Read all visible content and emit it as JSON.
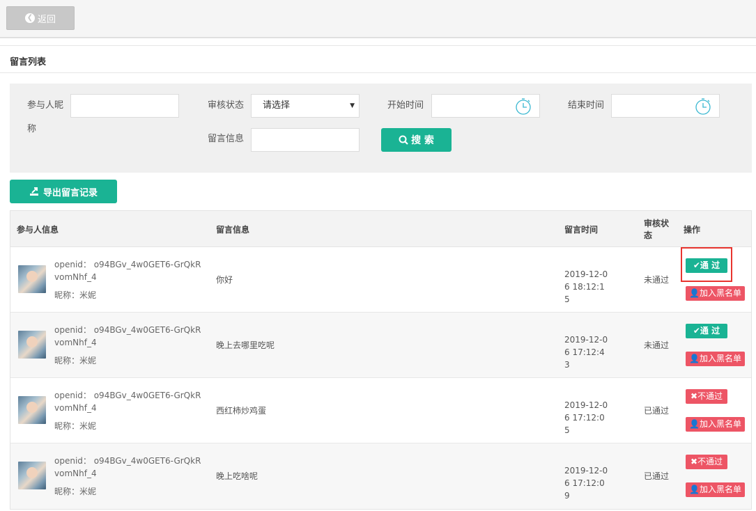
{
  "topbar": {
    "back_label": "返回"
  },
  "section": {
    "title": "留言列表"
  },
  "filter": {
    "nickname_label_1": "参与人昵",
    "nickname_label_2": "称",
    "status_label": "审核状态",
    "status_selected": "请选择",
    "start_label": "开始时间",
    "end_label": "结束时间",
    "message_label": "留言信息",
    "search_label": "搜 索"
  },
  "export_label": "导出留言记录",
  "table": {
    "headers": {
      "user": "参与人信息",
      "message": "留言信息",
      "time": "留言时间",
      "status": "审核状态",
      "action": "操作"
    },
    "rows": [
      {
        "openid": "openid： o94BGv_4w0GET6-GrQkRvomNhf_4",
        "nickname": "昵称：米妮",
        "message": "你好",
        "time": "2019-12-06 18:12:15",
        "status": "未通过",
        "action": "✔通 过",
        "blacklist": "加入黑名单"
      },
      {
        "openid": "openid： o94BGv_4w0GET6-GrQkRvomNhf_4",
        "nickname": "昵称：米妮",
        "message": "晚上去哪里吃呢",
        "time": "2019-12-06 17:12:43",
        "status": "未通过",
        "action": "✔通 过",
        "blacklist": "加入黑名单"
      },
      {
        "openid": "openid： o94BGv_4w0GET6-GrQkRvomNhf_4",
        "nickname": "昵称：米妮",
        "message": "西红柿炒鸡蛋",
        "time": "2019-12-06 17:12:05",
        "status": "已通过",
        "action": "✖不通过",
        "blacklist": "加入黑名单"
      },
      {
        "openid": "openid： o94BGv_4w0GET6-GrQkRvomNhf_4",
        "nickname": "昵称：米妮",
        "message": "晚上吃啥呢",
        "time": "2019-12-06 17:12:09",
        "status": "已通过",
        "action": "✖不通过",
        "blacklist": "加入黑名单"
      }
    ]
  },
  "colors": {
    "primary": "#1ab394",
    "danger": "#ed5565",
    "highlight": "#e8342f"
  }
}
